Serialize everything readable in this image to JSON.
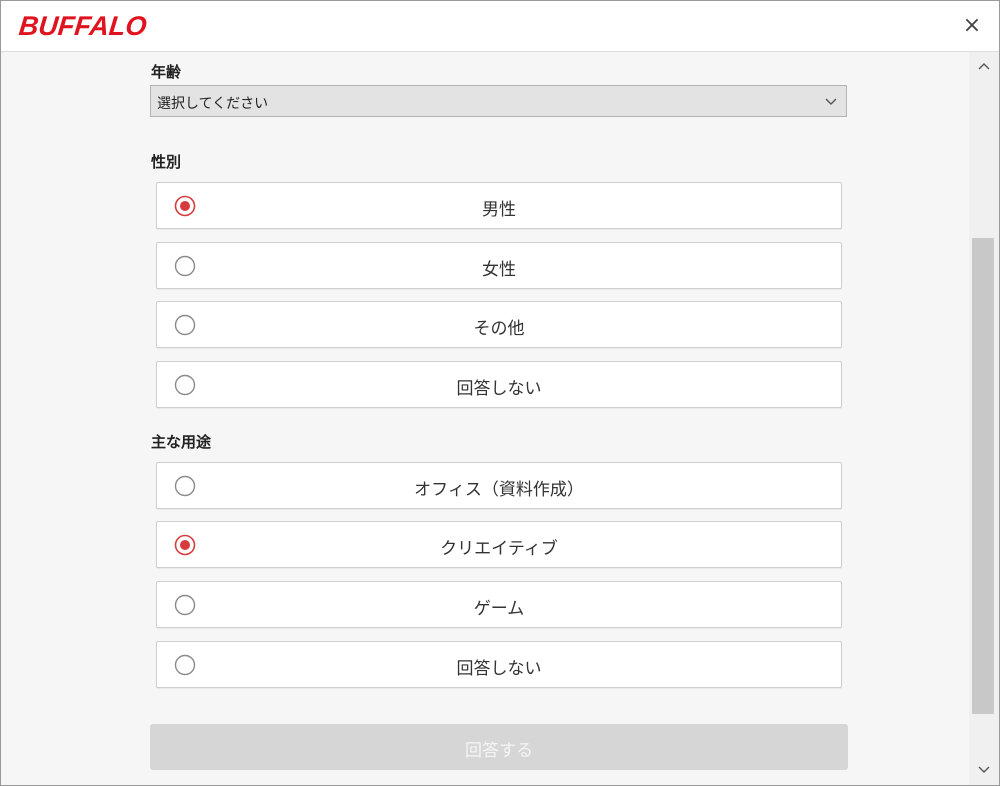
{
  "header": {
    "logo_text": "BUFFALO",
    "close_glyph": "×"
  },
  "age": {
    "label": "年齢",
    "selected_value": "選択してください"
  },
  "gender": {
    "label": "性別",
    "options": [
      {
        "label": "男性",
        "selected": true
      },
      {
        "label": "女性",
        "selected": false
      },
      {
        "label": "その他",
        "selected": false
      },
      {
        "label": "回答しない",
        "selected": false
      }
    ]
  },
  "usage": {
    "label": "主な用途",
    "options": [
      {
        "label": "オフィス（資料作成）",
        "selected": false
      },
      {
        "label": "クリエイティブ",
        "selected": true
      },
      {
        "label": "ゲーム",
        "selected": false
      },
      {
        "label": "回答しない",
        "selected": false
      }
    ]
  },
  "submit": {
    "label": "回答する",
    "enabled": false
  },
  "icons": {
    "close": "close-icon",
    "select": "chevron-down-icon",
    "scroll_up": "chevron-up-icon",
    "scroll_down": "chevron-down-icon",
    "radio_checked": "radio-checked-icon",
    "radio_unchecked": "radio-unchecked-icon"
  },
  "colors": {
    "brand": "#e0141e",
    "radio_selected": "#d83b3b",
    "radio_unselected": "#8a8a8a",
    "button_disabled": "#d6d6d6"
  }
}
